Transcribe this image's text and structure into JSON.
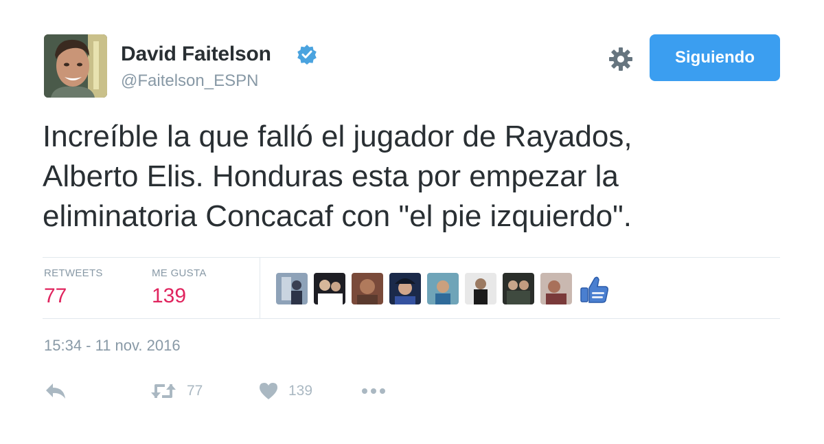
{
  "author": {
    "name": "David Faitelson",
    "handle": "@Faitelson_ESPN"
  },
  "follow_button": {
    "label": "Siguiendo"
  },
  "tweet": {
    "lines": [
      "Increíble la que falló el jugador de Rayados,",
      "Alberto Elis. Honduras esta por empezar la",
      "eliminatoria Concacaf con \"el pie izquierdo\"."
    ],
    "timestamp": "15:34 - 11 nov. 2016"
  },
  "stats": {
    "retweets_label": "RETWEETS",
    "retweets_value": "77",
    "likes_label": "ME GUSTA",
    "likes_value": "139"
  },
  "actions": {
    "retweet_count": "77",
    "like_count": "139"
  },
  "icons": {
    "verified": "verified-badge-icon",
    "gear": "gear-icon",
    "reply": "reply-icon",
    "retweet": "retweet-icon",
    "like": "heart-icon",
    "more": "more-dots-icon",
    "facepile_end": "thumbs-up-icon"
  },
  "colors": {
    "follow_button_bg": "#3b9ef0",
    "stat_value": "#e0245e",
    "verified": "#4aa3df",
    "muted": "#8899a6"
  }
}
